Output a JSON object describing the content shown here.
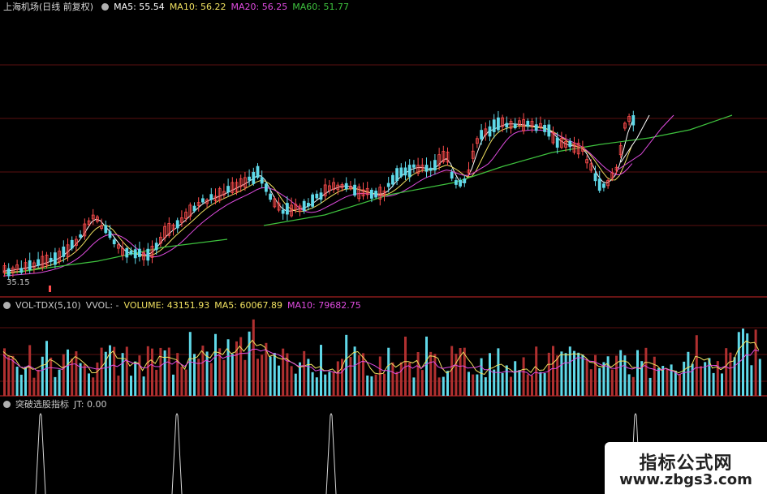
{
  "price_header": {
    "instrument": "上海机场(日线 前复权)",
    "ma5": "MA5: 55.54",
    "ma10": "MA10: 56.22",
    "ma20": "MA20: 56.25",
    "ma60": "MA60: 51.77"
  },
  "price_panel": {
    "low_label": "35.15"
  },
  "volume_header": {
    "indicator": "VOL-TDX(5,10)",
    "vvol": "VVOL: -",
    "volume": "VOLUME: 43151.93",
    "ma5": "MA5: 60067.89",
    "ma10": "MA10: 79682.75"
  },
  "signal_header": {
    "indicator": "突破选股指标",
    "jt": "JT: 0.00"
  },
  "watermark": {
    "title": "指标公式网",
    "url": "www.zbgs3.com"
  },
  "colors": {
    "up": "#ff4d4d",
    "up_vol": "#b03030",
    "down": "#5fd8e8",
    "ma5": "#ffffff",
    "ma10": "#f0e060",
    "ma20": "#e04ce0",
    "ma60": "#3ec23e",
    "grid": "#5a1010",
    "separator": "#8b1a1a"
  }
}
